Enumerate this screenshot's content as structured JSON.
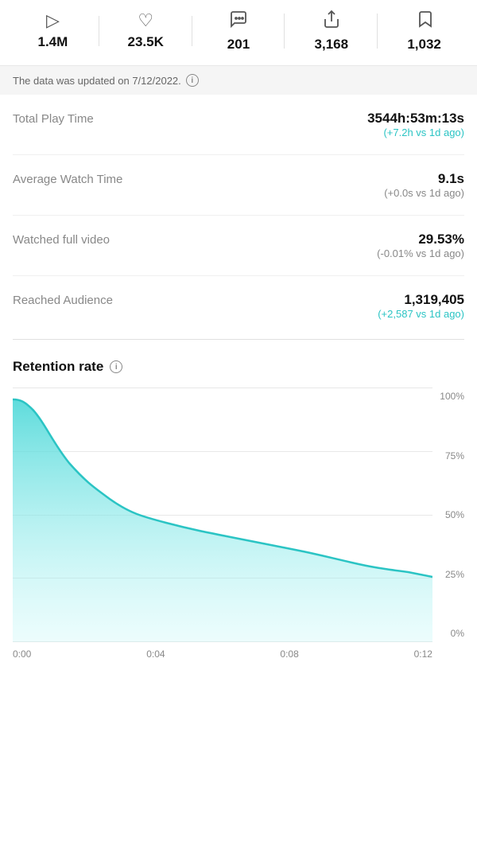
{
  "stats": {
    "items": [
      {
        "id": "plays",
        "icon": "▷",
        "value": "1.4M"
      },
      {
        "id": "likes",
        "icon": "♡",
        "value": "23.5K"
      },
      {
        "id": "comments",
        "icon": "💬",
        "value": "201"
      },
      {
        "id": "shares",
        "icon": "↗",
        "value": "3,168"
      },
      {
        "id": "saves",
        "icon": "🔖",
        "value": "1,032"
      }
    ]
  },
  "update_banner": {
    "text": "The data was updated on 7/12/2022.",
    "info_label": "i"
  },
  "metrics": [
    {
      "label": "Total Play Time",
      "main_value": "3544h:53m:13s",
      "change": "(+7.2h vs 1d ago)",
      "change_type": "positive"
    },
    {
      "label": "Average Watch Time",
      "main_value": "9.1s",
      "change": "(+0.0s vs 1d ago)",
      "change_type": "negative"
    },
    {
      "label": "Watched full video",
      "main_value": "29.53%",
      "change": "(-0.01% vs 1d ago)",
      "change_type": "negative"
    },
    {
      "label": "Reached Audience",
      "main_value": "1,319,405",
      "change": "(+2,587 vs 1d ago)",
      "change_type": "positive"
    }
  ],
  "retention": {
    "title": "Retention rate",
    "info_label": "i",
    "y_labels": [
      "100%",
      "75%",
      "50%",
      "25%",
      "0%"
    ],
    "x_labels": [
      "0:00",
      "0:04",
      "0:08",
      "0:12"
    ]
  },
  "colors": {
    "teal": "#2bc4c4",
    "teal_fill_top": "#4dd8d8",
    "teal_fill_bottom": "rgba(180, 245, 245, 0.2)"
  }
}
